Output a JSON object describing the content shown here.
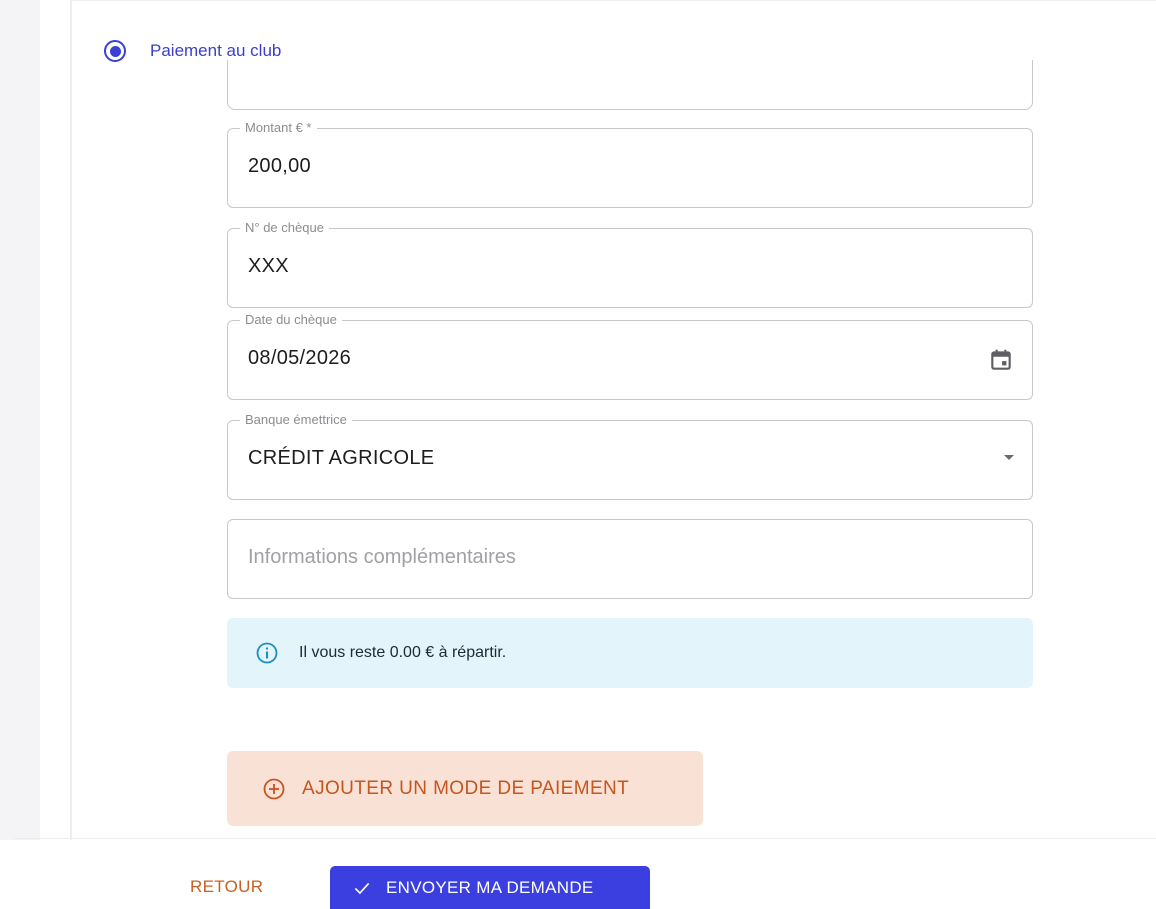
{
  "payment_option": {
    "label": "Paiement au club",
    "selected": true
  },
  "form": {
    "amount": {
      "label": "Montant € *",
      "value": "200,00"
    },
    "cheque_number": {
      "label": "N° de chèque",
      "value": "XXX"
    },
    "cheque_date": {
      "label": "Date du chèque",
      "value": "08/05/2026",
      "icon": "calendar-icon"
    },
    "bank": {
      "label": "Banque émettrice",
      "value": "CRÉDIT AGRICOLE",
      "icon": "dropdown-arrow-icon"
    },
    "extra_info": {
      "placeholder": "Informations complémentaires",
      "value": ""
    }
  },
  "info_banner": {
    "text": "Il vous reste 0.00 € à répartir.",
    "icon": "info-icon"
  },
  "add_payment_button": {
    "label": "AJOUTER UN MODE DE PAIEMENT",
    "icon": "plus-circle-icon"
  },
  "actions": {
    "back_label": "RETOUR",
    "submit_label": "ENVOYER MA DEMANDE",
    "submit_icon": "check-icon"
  },
  "colors": {
    "primary": "#3b3fe0",
    "accent_orange": "#c4561e",
    "add_button_bg": "#f9e1d6",
    "info_bg": "#e3f4fb",
    "info_icon": "#1a8fc4"
  }
}
